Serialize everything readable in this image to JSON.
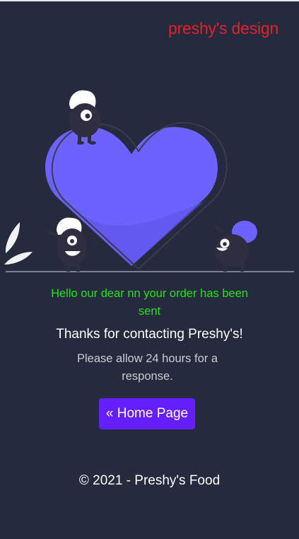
{
  "brand": {
    "name": "preshy's design",
    "color": "#e0222f"
  },
  "illustration": {
    "heart_color": "#6c63ff",
    "character_color": "#2f2e41",
    "accent_color": "#ffffff",
    "leaf_color": "#f2f2f2"
  },
  "messages": {
    "order_sent": "Hello our dear nn your order has been sent",
    "order_sent_color": "#22e21e",
    "thanks": "Thanks for contacting Preshy's!",
    "allow": "Please allow 24 hours for a response."
  },
  "home_button": {
    "label": "« Home Page",
    "color": "#651ffe"
  },
  "footer": {
    "copyright": "© 2021 - Preshy's Food"
  },
  "colors": {
    "background": "#262a3d"
  }
}
